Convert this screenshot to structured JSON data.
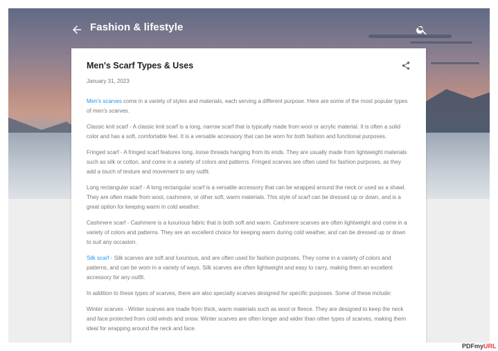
{
  "header": {
    "blog_title": "Fashion & lifestyle",
    "back_icon": "arrow-left-icon",
    "search_icon": "search-icon"
  },
  "post": {
    "title": "Men's Scarf Types & Uses",
    "date": "January 31, 2023",
    "share_icon": "share-icon",
    "intro": {
      "link": "Men's scarves",
      "text": " come in a variety of styles and materials, each serving a different purpose. Here are some of the most popular types of men's scarves."
    },
    "p_classic": "Classic knit scarf - A classic knit scarf is a long, narrow scarf that is typically made from wool or acrylic material. It is often a solid color and has a soft, comfortable feel. It is a versatile accessory that can be worn for both fashion and functional purposes.",
    "p_fringed": "Fringed scarf - A fringed scarf features long, loose threads hanging from its ends. They are usually made from lightweight materials such as silk or cotton, and come in a variety of colors and patterns. Fringed scarves are often used for fashion purposes, as they add a touch of texture and movement to any outfit.",
    "p_long": "Long rectangular scarf - A long rectangular scarf is a versatile accessory that can be wrapped around the neck or used as a shawl. They are often made from wool, cashmere, or other soft, warm materials. This style of scarf can be dressed up or down, and is a great option for keeping warm in cold weather.",
    "p_cashmere": "Cashmere scarf - Cashmere is a luxurious fabric that is both soft and warm. Cashmere scarves are often lightweight and come in a variety of colors and patterns. They are an excellent choice for keeping warm during cold weather, and can be dressed up or down to suit any occasion.",
    "silk": {
      "link": "Silk scarf",
      "text": " - Silk scarves are soft and luxurious, and are often used for fashion purposes. They come in a variety of colors and patterns, and can be worn in a variety of ways. Silk scarves are often lightweight and easy to carry, making them an excellent accessory for any outfit."
    },
    "p_specialty": "In addition to these types of scarves, there are also specialty scarves designed for specific purposes. Some of these include:",
    "p_winter": "Winter scarves - Winter scarves are made from thick, warm materials such as wool or fleece. They are designed to keep the neck and face protected from cold winds and snow. Winter scarves are often longer and wider than other types of scarves, making them ideal for wrapping around the neck and face."
  },
  "watermark": {
    "text_a": "PDFmy",
    "text_b": "URL"
  },
  "colors": {
    "link": "#2196f3",
    "body_text": "#757575",
    "title_text": "#212121"
  }
}
